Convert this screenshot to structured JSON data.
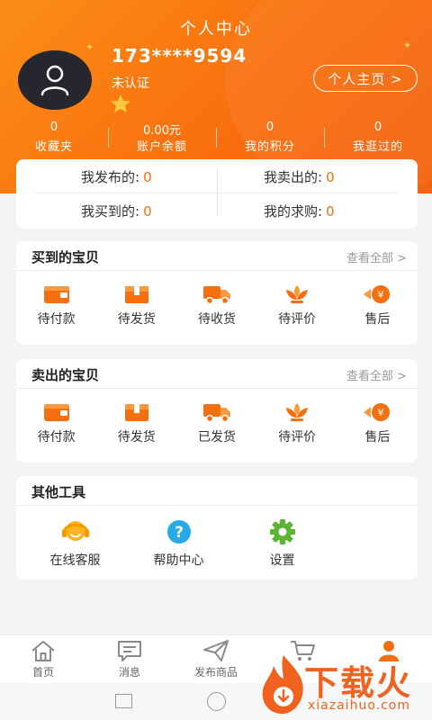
{
  "header": {
    "title": "个人中心",
    "phone": "173****9594",
    "verify_status": "未认证",
    "home_button": "个人主页 >"
  },
  "stats": [
    {
      "value": "0",
      "label": "收藏夹"
    },
    {
      "value": "0.00元",
      "label": "账户余额"
    },
    {
      "value": "0",
      "label": "我的积分"
    },
    {
      "value": "0",
      "label": "我逛过的"
    }
  ],
  "summary": {
    "published_label": "我发布的:",
    "published_value": "0",
    "sold_label": "我卖出的:",
    "sold_value": "0",
    "bought_label": "我买到的:",
    "bought_value": "0",
    "wanted_label": "我的求购:",
    "wanted_value": "0"
  },
  "bought": {
    "title": "买到的宝贝",
    "view_all": "查看全部  >",
    "items": [
      {
        "label": "待付款",
        "icon": "wallet-icon"
      },
      {
        "label": "待发货",
        "icon": "package-icon"
      },
      {
        "label": "待收货",
        "icon": "truck-icon"
      },
      {
        "label": "待评价",
        "icon": "flower-icon"
      },
      {
        "label": "售后",
        "icon": "yen-refund-icon"
      }
    ]
  },
  "sold": {
    "title": "卖出的宝贝",
    "view_all": "查看全部  >",
    "items": [
      {
        "label": "待付款",
        "icon": "wallet-icon"
      },
      {
        "label": "待发货",
        "icon": "package-icon"
      },
      {
        "label": "已发货",
        "icon": "truck-icon"
      },
      {
        "label": "待评价",
        "icon": "flower-icon"
      },
      {
        "label": "售后",
        "icon": "yen-refund-icon"
      }
    ]
  },
  "tools": {
    "title": "其他工具",
    "items": [
      {
        "label": "在线客服",
        "icon": "headset-icon"
      },
      {
        "label": "帮助中心",
        "icon": "help-icon"
      },
      {
        "label": "设置",
        "icon": "gear-icon"
      }
    ]
  },
  "tabbar": [
    {
      "label": "首页",
      "icon": "home-icon"
    },
    {
      "label": "消息",
      "icon": "message-icon"
    },
    {
      "label": "发布商品",
      "icon": "send-icon"
    },
    {
      "label": "",
      "icon": "cart-icon"
    },
    {
      "label": "",
      "icon": "user-icon"
    }
  ],
  "watermark": {
    "text": "下载火",
    "url": "xiazaihuo.com"
  },
  "colors": {
    "accent": "#f36f10",
    "header_start": "#fa8d16",
    "header_end": "#f4620d"
  }
}
